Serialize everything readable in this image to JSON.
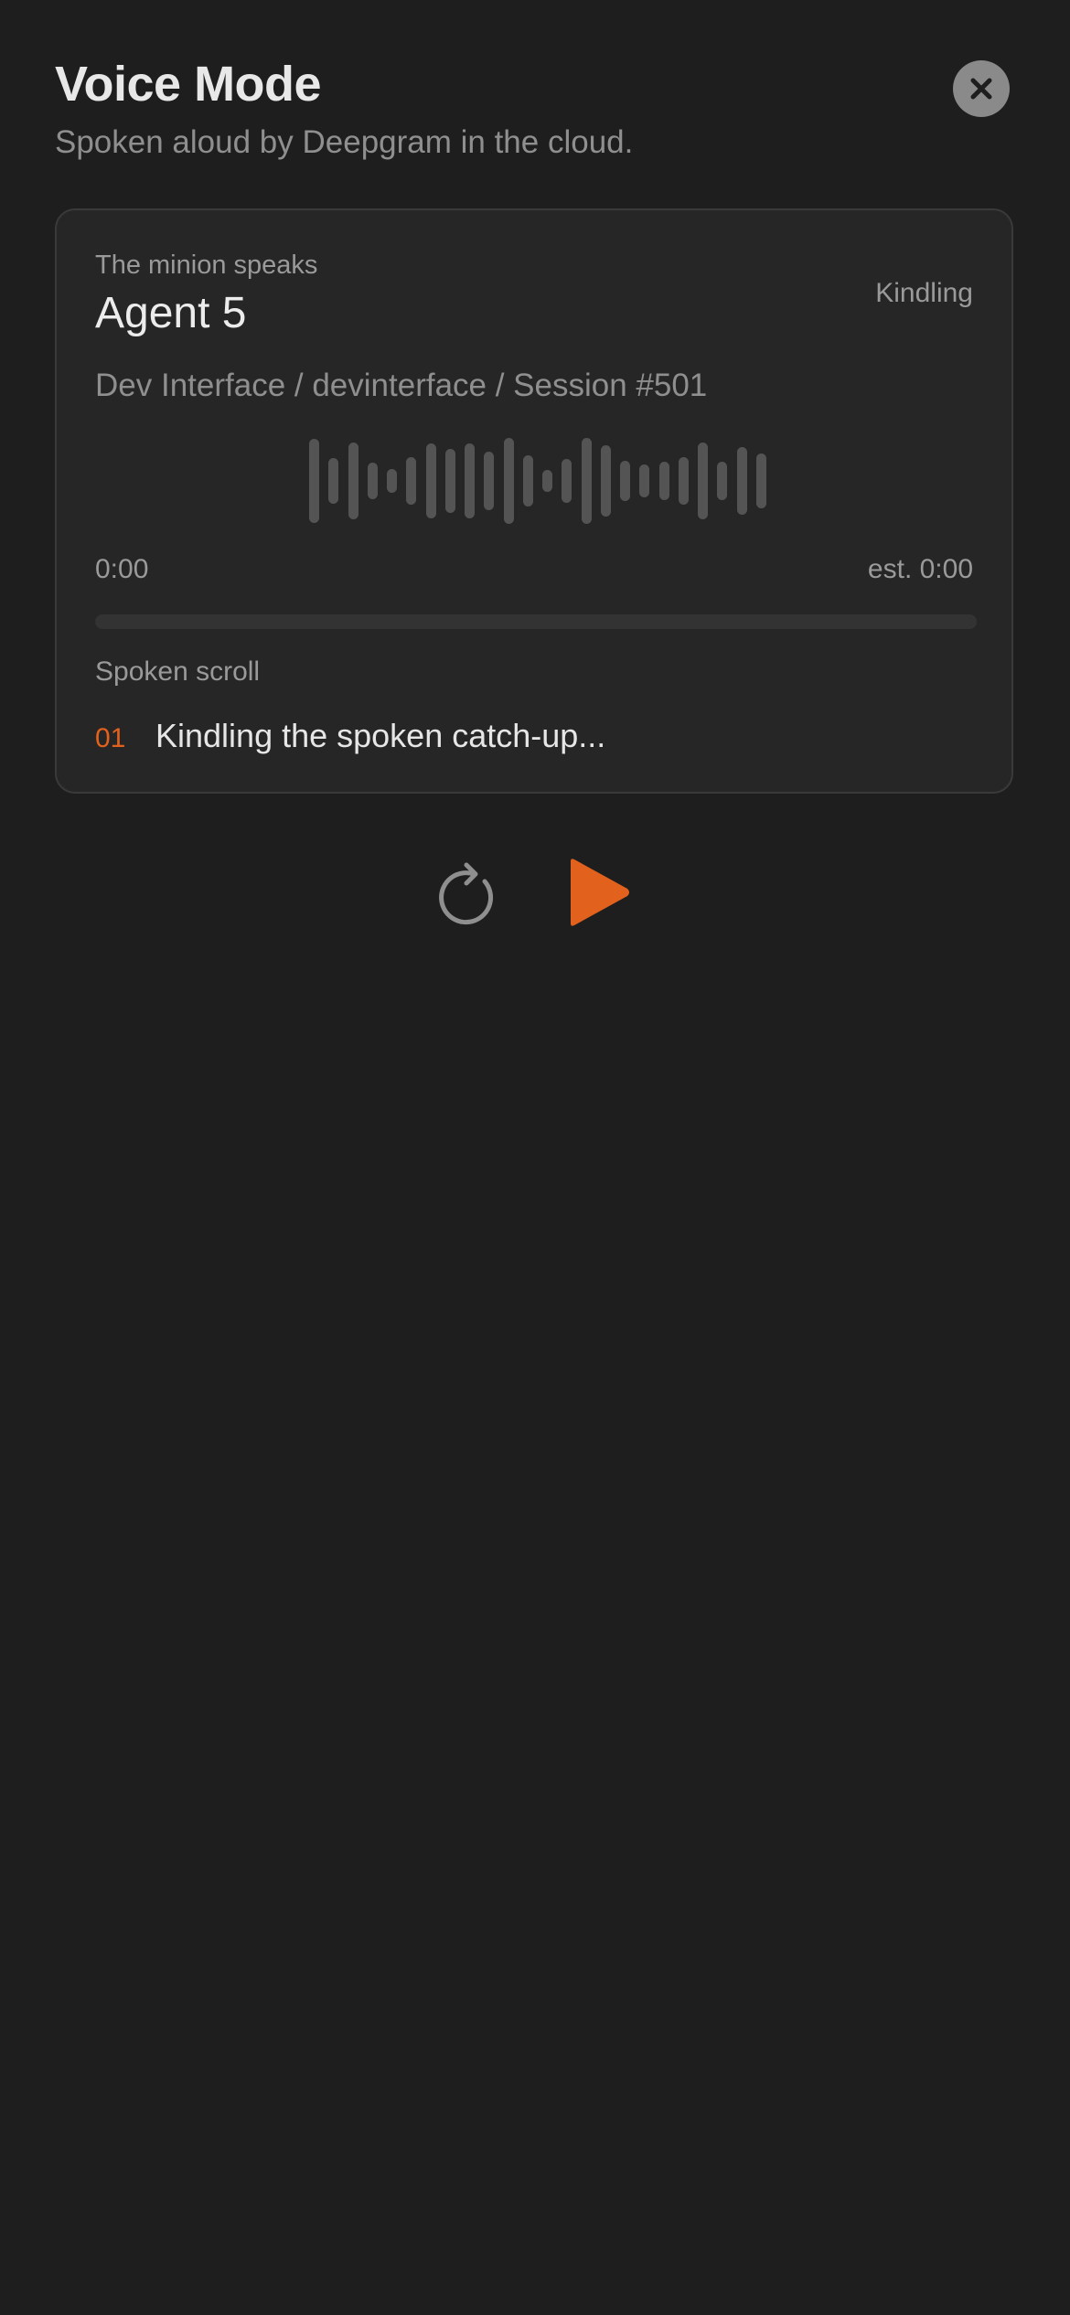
{
  "header": {
    "title": "Voice Mode",
    "subtitle": "Spoken aloud by Deepgram in the cloud.",
    "close_icon": "close-icon"
  },
  "card": {
    "eyebrow": "The minion speaks",
    "agent_name": "Agent 5",
    "status": "Kindling",
    "path": "Dev Interface / devinterface / Session #501",
    "waveform_icon": "waveform",
    "time_start": "0:00",
    "time_end": "est. 0:00",
    "progress_percent": 0,
    "section_label": "Spoken scroll",
    "items": [
      {
        "index": "01",
        "text": "Kindling the spoken catch-up..."
      }
    ]
  },
  "controls": {
    "replay_icon": "replay-icon",
    "play_icon": "play-icon"
  },
  "colors": {
    "background": "#1e1e1e",
    "card_background": "#262626",
    "accent": "#e2621d",
    "muted_text": "#8f8f8f"
  }
}
